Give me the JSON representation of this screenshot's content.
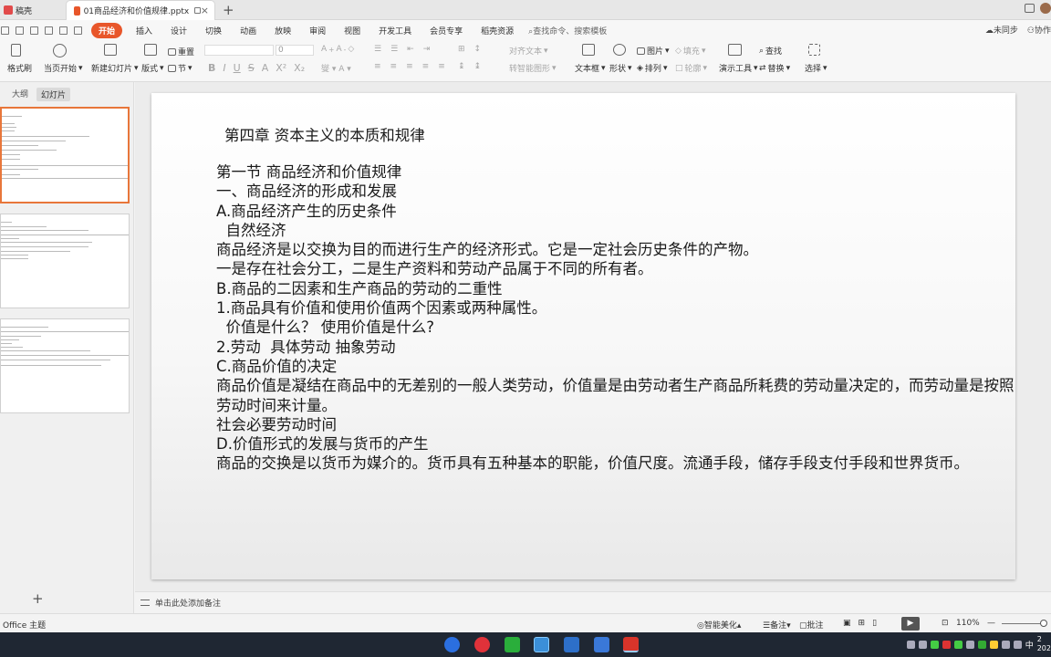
{
  "tabs": {
    "home": "稿壳",
    "document": "01商品经济和价值规律.pptx"
  },
  "menu": {
    "items": [
      "开始",
      "插入",
      "设计",
      "切换",
      "动画",
      "放映",
      "审阅",
      "视图",
      "开发工具",
      "会员专享",
      "稻壳资源"
    ],
    "search": "查找命令、搜索模板",
    "sync": "未同步",
    "collab": "协作"
  },
  "ribbon": {
    "format_brush": "格式刷",
    "play_from_current": "当页开始",
    "new_slide": "新建幻灯片",
    "layout": "版式",
    "section": "节",
    "reset": "重置",
    "font_size": "0",
    "text_box": "文本框",
    "shape": "形状",
    "picture": "图片",
    "fill": "填充",
    "arrange": "排列",
    "outline": "轮廓",
    "presentation_tools": "演示工具",
    "find": "查找",
    "replace": "替换",
    "select": "选择",
    "align_text": "对齐文本",
    "smartart": "转智能图形"
  },
  "panel": {
    "tab_outline": "大纲",
    "tab_slides": "幻灯片",
    "add": "+"
  },
  "slide": {
    "title": "第四章 资本主义的本质和规律",
    "lines": [
      "第一节 商品经济和价值规律",
      "一、商品经济的形成和发展",
      "A.商品经济产生的历史条件",
      "  自然经济",
      "商品经济是以交换为目的而进行生产的经济形式。它是一定社会历史条件的产物。",
      "一是存在社会分工，二是生产资料和劳动产品属于不同的所有者。",
      "B.商品的二因素和生产商品的劳动的二重性",
      "1.商品具有价值和使用价值两个因素或两种属性。",
      "  价值是什么？ 使用价值是什么?",
      "2.劳动  具体劳动 抽象劳动",
      "C.商品价值的决定",
      "商品价值是凝结在商品中的无差别的一般人类劳动，价值量是由劳动者生产商品所耗费的劳动量决定的，而劳动量是按照劳动时间来计量。",
      "社会必要劳动时间",
      "D.价值形式的发展与货币的产生",
      "商品的交换是以货币为媒介的。货币具有五种基本的职能，价值尺度。流通手段，储存手段支付手段和世界货币。"
    ]
  },
  "notes": {
    "placeholder": "单击此处添加备注"
  },
  "status": {
    "theme": "Office 主题",
    "beautify": "智能美化",
    "notes": "备注",
    "comments": "批注",
    "zoom": "110%"
  },
  "taskbar": {
    "ime": "中",
    "clock_top": "2",
    "clock_bottom": "202"
  }
}
